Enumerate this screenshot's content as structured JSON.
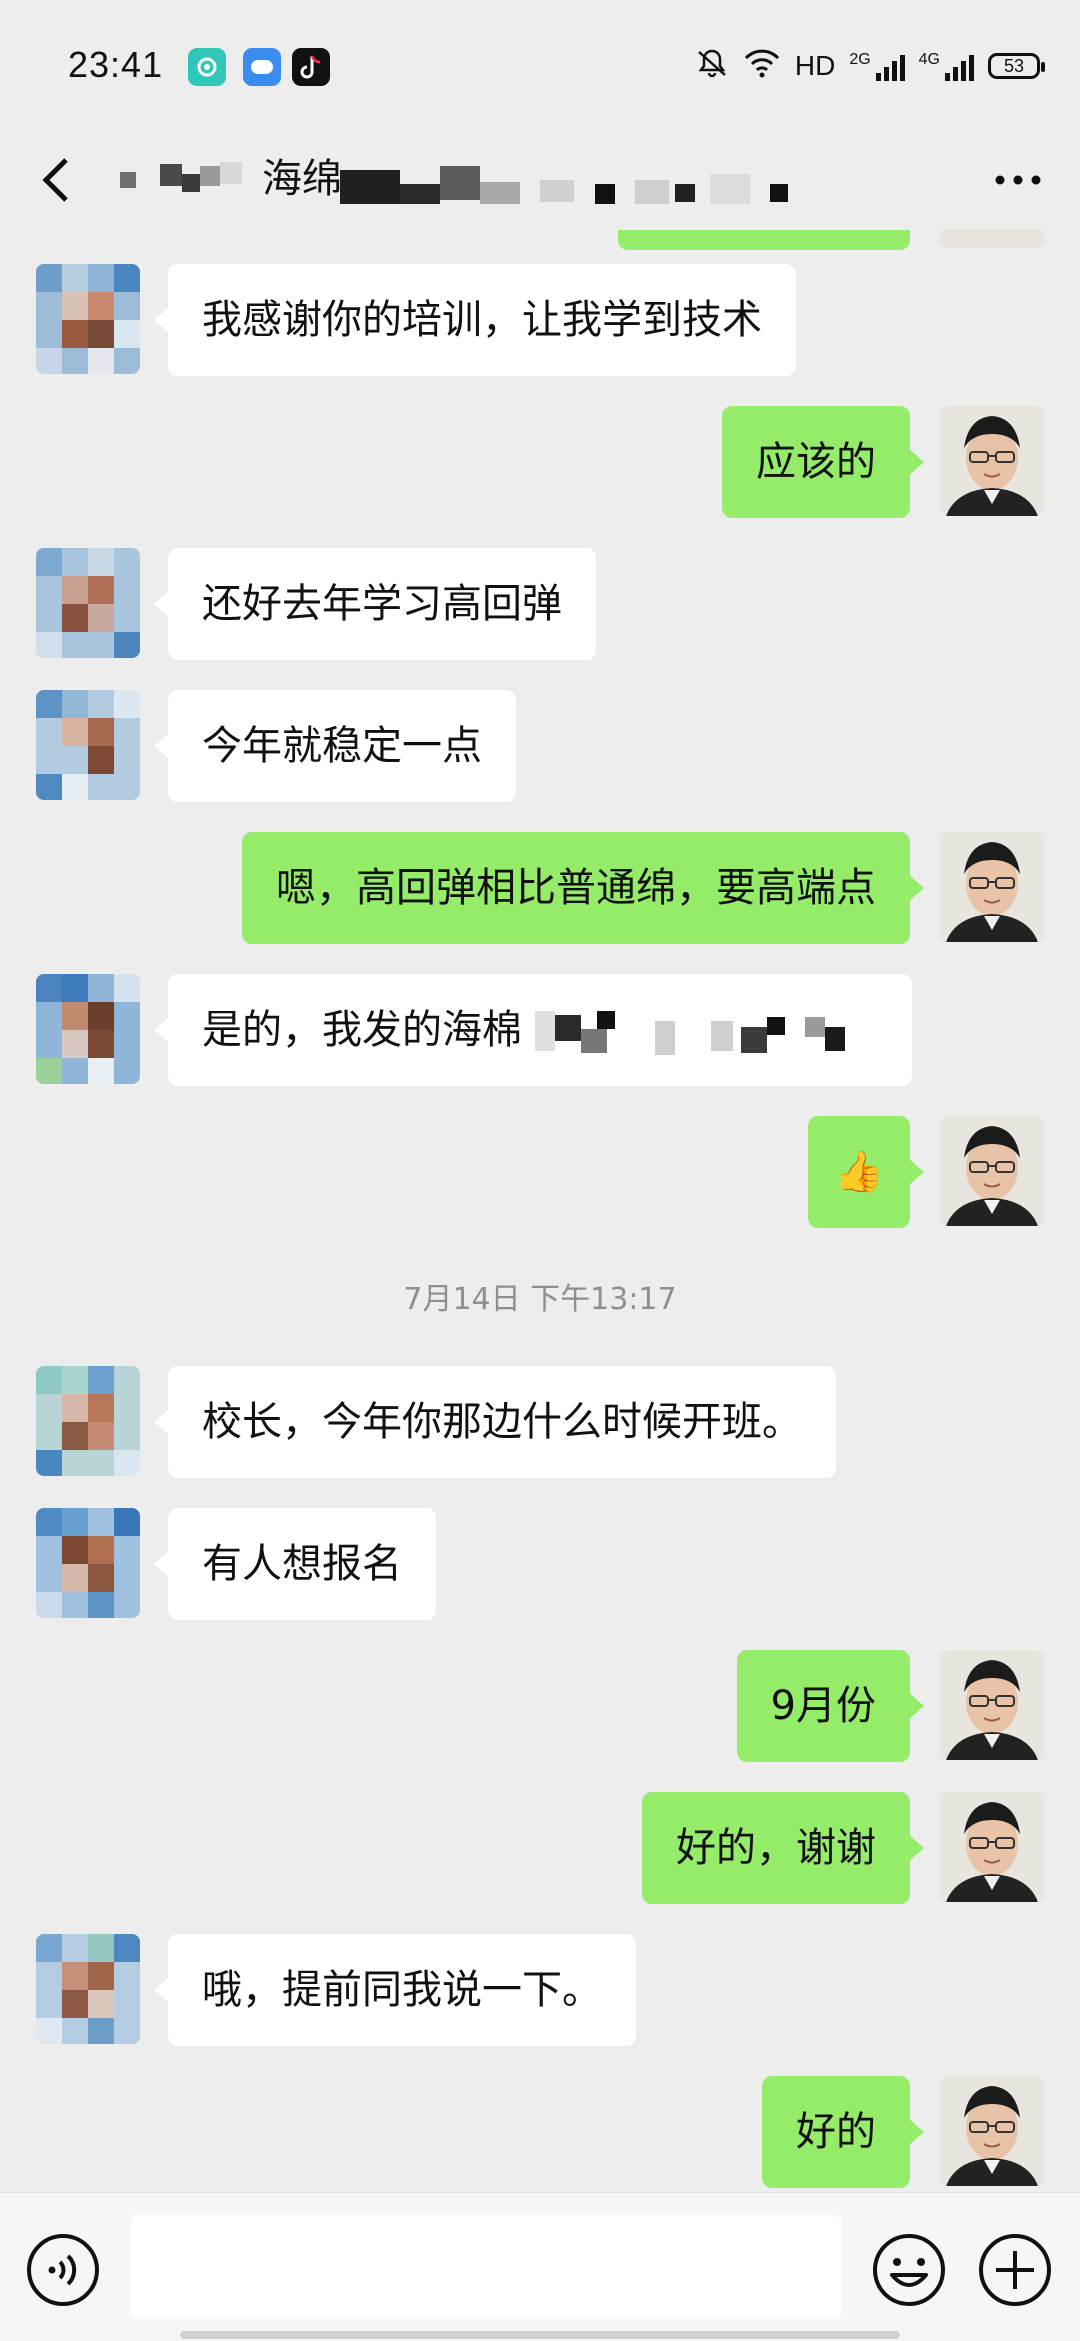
{
  "status_bar": {
    "time": "23:41",
    "network": "HD",
    "sig1_label": "2G",
    "sig2_label": "4G",
    "battery": "53",
    "icons": [
      "app-icon",
      "cloud-icon",
      "tiktok-icon",
      "mute-icon",
      "wifi-icon",
      "signal-icon",
      "signal-icon",
      "battery-icon"
    ]
  },
  "header": {
    "title": "海绵",
    "back_icon": "back-arrow-icon",
    "more_icon": "more-dots-icon"
  },
  "messages": [
    {
      "side": "left",
      "text": "我感谢你的培训，让我学到技术"
    },
    {
      "side": "right",
      "text": "应该的"
    },
    {
      "side": "left",
      "text": "还好去年学习高回弹"
    },
    {
      "side": "left",
      "text": "今年就稳定一点"
    },
    {
      "side": "right",
      "text": "嗯，高回弹相比普通绵，要高端点"
    },
    {
      "side": "left",
      "text": "是的，我发的海棉"
    },
    {
      "side": "right",
      "text": "👍"
    },
    {
      "side": "left",
      "text": "校长，今年你那边什么时候开班。"
    },
    {
      "side": "left",
      "text": "有人想报名"
    },
    {
      "side": "right",
      "text": "9月份"
    },
    {
      "side": "right",
      "text": "好的，谢谢"
    },
    {
      "side": "left",
      "text": "哦，提前同我说一下。"
    },
    {
      "side": "right",
      "text": "好的"
    }
  ],
  "timestamp": "7月14日 下午13:17",
  "input_bar": {
    "placeholder": "",
    "voice_icon": "voice-icon",
    "emoji_icon": "emoji-icon",
    "add_icon": "plus-icon"
  },
  "colors": {
    "background": "#ededed",
    "bubble_self": "#95ec69",
    "bubble_other": "#ffffff"
  }
}
